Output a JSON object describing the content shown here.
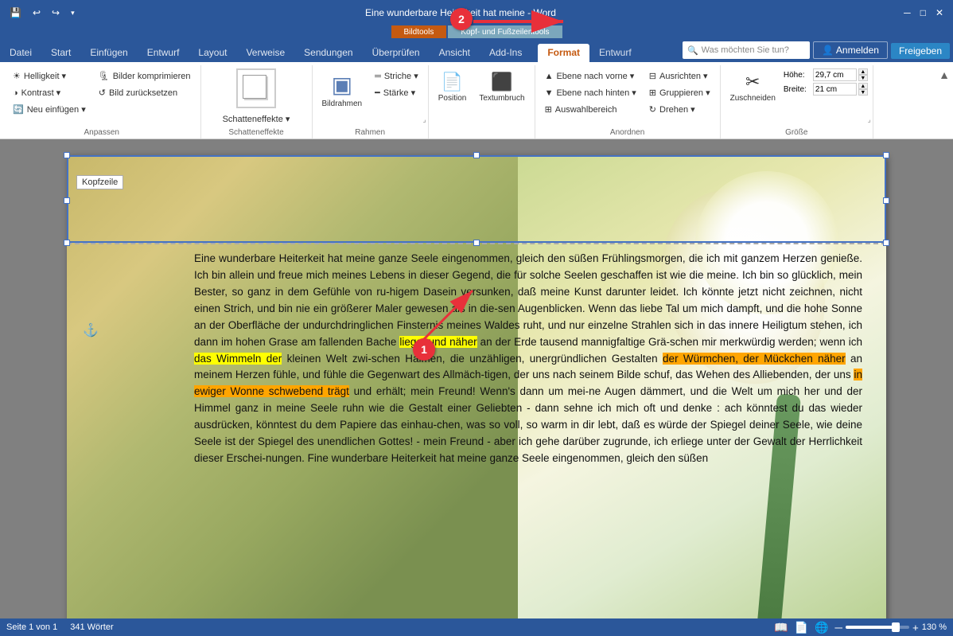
{
  "titleBar": {
    "title": "Eine wunderbare Heiterkeit hat meine - Word",
    "saveIcon": "💾",
    "undoIcon": "↩",
    "redoIcon": "↪",
    "dropdownIcon": "▾",
    "minimizeIcon": "─",
    "restoreIcon": "□",
    "closeIcon": "✕"
  },
  "contextualHeaders": {
    "bildtools": "Bildtools",
    "kopffuss": "Kopf- und Fußzeilentools"
  },
  "ribbonTabs": {
    "main": [
      "Datei",
      "Start",
      "Einfügen",
      "Entwurf",
      "Layout",
      "Verweise",
      "Sendungen",
      "Überprüfen",
      "Ansicht",
      "Add-Ins"
    ],
    "contextual": [
      "Format",
      "Entwurf"
    ],
    "activeMain": "Format",
    "helpSearch": "Was möchten Sie tun?",
    "signIn": "Anmelden",
    "share": "Freigeben"
  },
  "ribbonGroups": {
    "anpassen": {
      "label": "Anpassen",
      "buttons": [
        "Helligkeit ▾",
        "Kontrast ▾",
        "Neu einfügen ▾"
      ],
      "rightButtons": [
        "Bilder komprimieren",
        "Bild zurücksetzen"
      ]
    },
    "schatteneffekte": {
      "label": "Schatteneffekte",
      "previewBox": "□",
      "buttons": [
        "Schatteneffekte ▾"
      ]
    },
    "rahmen": {
      "label": "Rahmen",
      "mainBtn": "Bildrahmen",
      "buttons": [
        "Striche ▾",
        "Stärke ▾"
      ],
      "expandIcon": "⌟"
    },
    "posTools": {
      "buttons": [
        "Position",
        "Textumbruch"
      ]
    },
    "anordnen": {
      "label": "Anordnen",
      "buttons": [
        "Ebene nach vorne ▾",
        "Ebene nach hinten ▾",
        "Auswahlbereich"
      ],
      "rightButtons": [
        "Ausrichten ▾",
        "Gruppieren ▾",
        "Drehen ▾"
      ]
    },
    "grosse": {
      "label": "Größe",
      "hoehe": {
        "label": "Höhe:",
        "value": "29,7 cm"
      },
      "breite": {
        "label": "Breite:",
        "value": "21 cm"
      },
      "zuschneiden": "Zuschneiden",
      "expandIcon": "⌟"
    }
  },
  "document": {
    "headerLabel": "Kopfzeile",
    "text": "Eine wunderbare Heiterkeit hat meine ganze Seele eingenommen, gleich den süßen Frühlingsmorgen, die ich mit ganzem Herzen genieße. Ich bin allein und freue mich meines Lebens in dieser Gegend, die für solche Seelen geschaffen ist wie die meine. Ich bin so glücklich, mein Bester, so ganz in dem Gefühle von ru-higem Dasein versunken, daß meine Kunst darunter leidet. Ich könnte jetzt nicht zeichnen, nicht einen Strich, und bin nie ein größerer Maler gewesen als in die-sen Augenblicken. Wenn das liebe Tal um mich dampft, und die hohe Sonne an der Oberfläche der undurchdringlichen Finsternis meines Waldes ruht, und nur einzelne Strahlen sich in das innere Heiligtum stehen, ich dann im hohen Grase am fallenden Bache liege, und näher an der Erde tausend mannigfaltige Grä-schen mir merkwürdig werden; wenn ich das Wimmeln der kleinen Welt zwi-schen Halmen, die unzähligen, unergründlichen Gestalten der Würmchen, der Mückchen näher an meinem Herzen fühle, und fühle die Gegenwart des Allmäch-tigen, der uns nach seinem Bilde schuf, das Wehen des Alliebenden, der uns in ewiger Wonne schwebend trägt und erhält; mein Freund! Wenn's dann um mei-ne Augen dämmert, und die Welt um mich her und der Himmel ganz in meine Seele ruhn wie die Gestalt einer Geliebten - dann sehne ich mich oft und denke : ach könntest du das wieder ausdrücken, könntest du dem Papiere das einhau-chen, was so voll, so warm in dir lebt, daß es würde der Spiegel deiner Seele, wie deine Seele ist der Spiegel des unendlichen Gottes! - mein Freund - aber ich gehe darüber zugrunde, ich erliege unter der Gewalt der Herrlichkeit dieser Erschei-nungen. Fine wunderbare Heiterkeit hat meine ganze Seele eingenommen, gleich den süßen"
  },
  "statusBar": {
    "page": "Seite 1 von 1",
    "words": "341 Wörter",
    "zoom": "130 %"
  },
  "annotations": {
    "circle1": "1",
    "circle2": "2"
  }
}
